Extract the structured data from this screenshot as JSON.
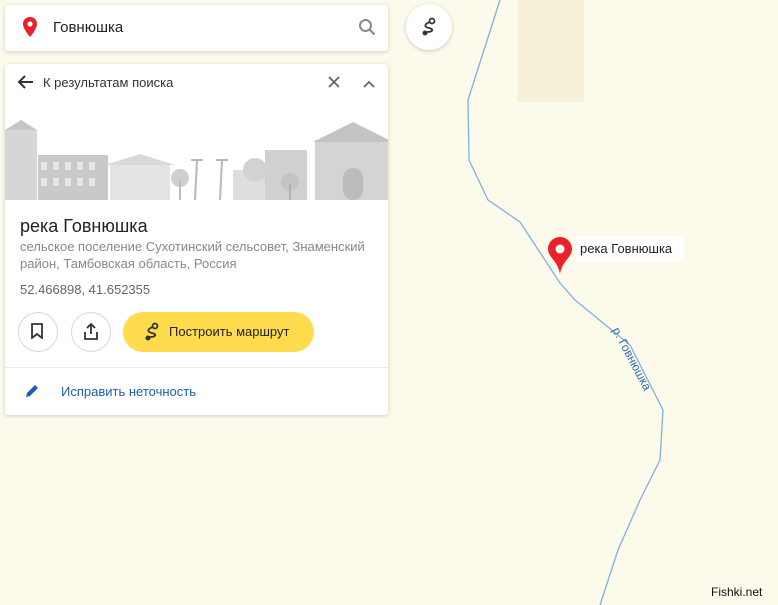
{
  "search": {
    "query": "Говнюшка"
  },
  "card": {
    "back_label": "К результатам поиска",
    "title": "река Говнюшка",
    "address": "сельское поселение Сухотинский сельсовет, Знаменский район, Тамбовская область, Россия",
    "coordinates": "52.466898, 41.652355",
    "build_route_label": "Построить маршрут",
    "fix_label": "Исправить неточность"
  },
  "map": {
    "marker_label": "река Говнюшка",
    "river_label": "р. Говнюшка",
    "watermark": "Fishki.net"
  },
  "colors": {
    "pin_red": "#e8212b",
    "route_yellow": "#ffdb4d",
    "river_blue": "#7fb1e0",
    "map_bg": "#fcfaeb"
  }
}
